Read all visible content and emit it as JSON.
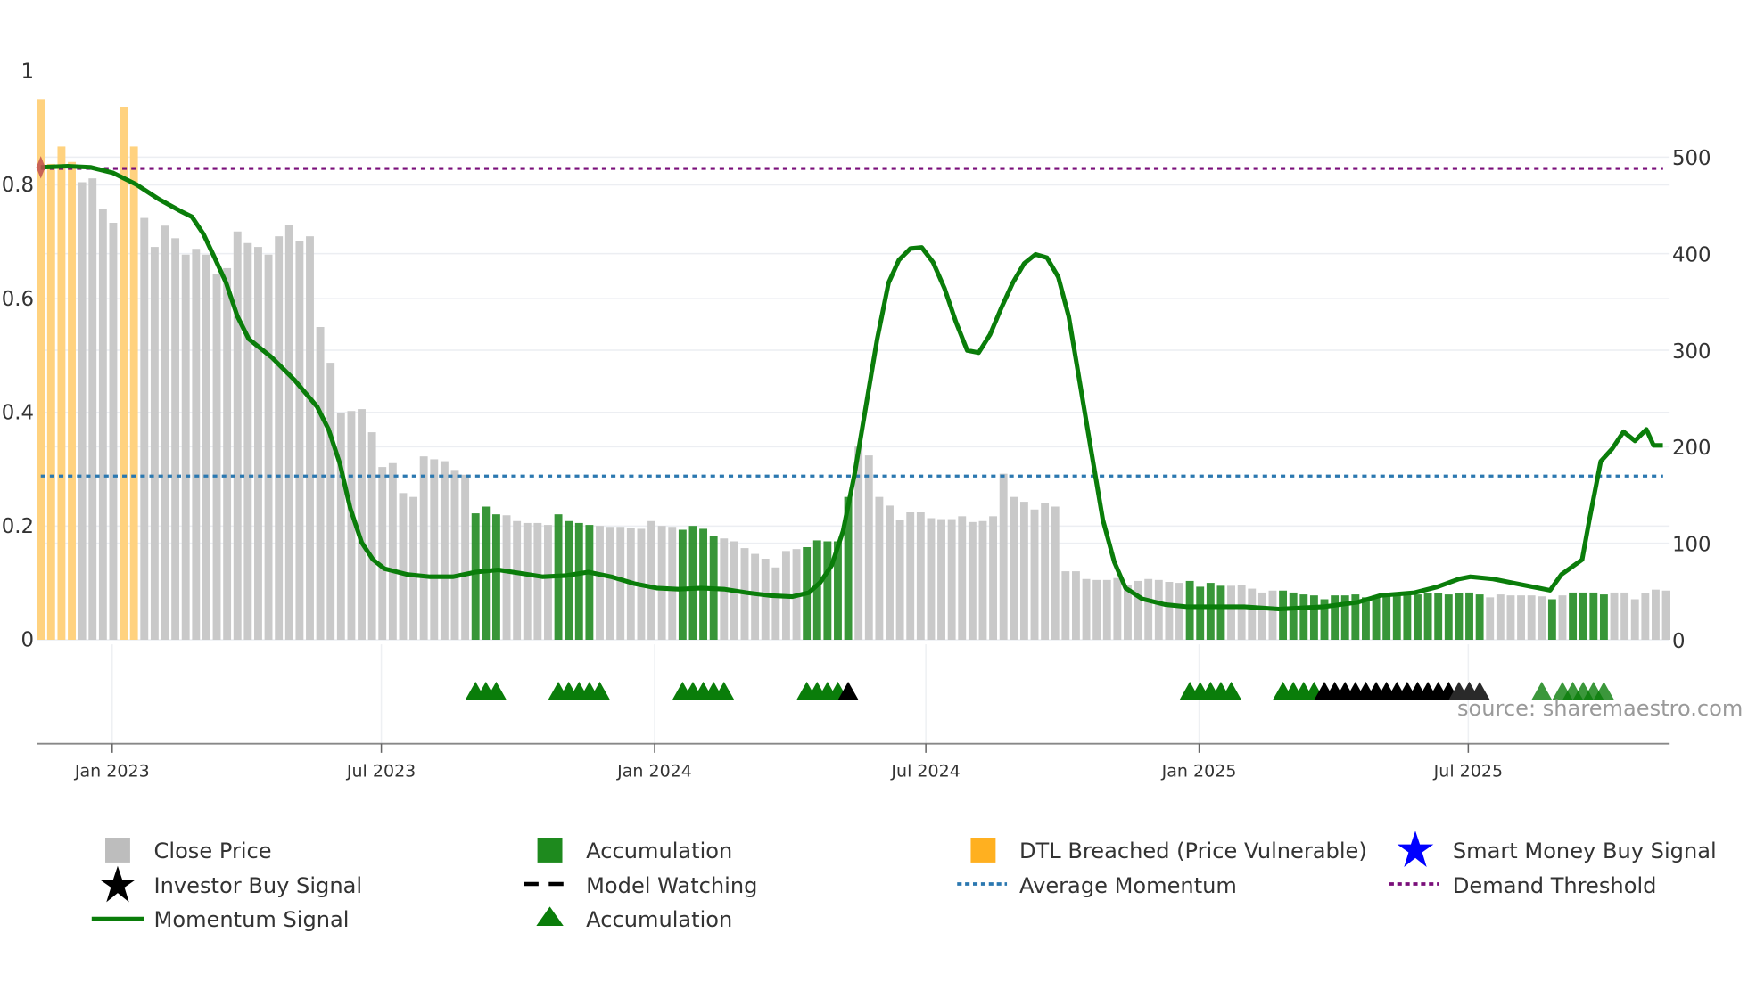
{
  "chart_data": {
    "type": "bar+line",
    "x_unit": "weeks since start",
    "x_ticks": [
      {
        "label": "Jan 2023",
        "week": 6.9
      },
      {
        "label": "Jul 2023",
        "week": 32.9
      },
      {
        "label": "Jan 2024",
        "week": 59.3
      },
      {
        "label": "Jul 2024",
        "week": 85.5
      },
      {
        "label": "Jan 2025",
        "week": 111.9
      },
      {
        "label": "Jul 2025",
        "week": 137.9
      }
    ],
    "left_axis": {
      "ylim": [
        0,
        1
      ],
      "ticks": [
        "0",
        "0.2",
        "0.4",
        "0.6",
        "0.8",
        "1"
      ],
      "tick_values": [
        0,
        0.2,
        0.4,
        0.6,
        0.8,
        1
      ]
    },
    "right_axis": {
      "ylim": [
        0,
        589
      ],
      "ticks": [
        "0",
        "100",
        "200",
        "300",
        "400",
        "500"
      ],
      "tick_values": [
        0,
        100,
        200,
        300,
        400,
        500
      ]
    },
    "close_price": [
      560,
      493,
      511,
      495,
      474,
      478,
      446,
      432,
      552,
      511,
      437,
      407,
      429,
      416,
      399,
      405,
      399,
      379,
      385,
      423,
      411,
      407,
      399,
      418,
      430,
      413,
      418,
      324,
      287,
      235,
      237,
      239,
      215,
      179,
      183,
      152,
      148,
      190,
      187,
      185,
      176,
      171,
      131,
      138,
      130,
      129,
      123,
      121,
      121,
      119,
      130,
      123,
      121,
      119,
      118,
      117,
      117,
      116,
      115,
      123,
      118,
      117,
      114,
      118,
      115,
      108,
      105,
      102,
      95,
      89,
      84,
      75,
      92,
      94,
      96,
      103,
      102,
      102,
      148,
      201,
      191,
      148,
      139,
      124,
      132,
      132,
      126,
      125,
      125,
      128,
      122,
      123,
      128,
      172,
      148,
      143,
      135,
      142,
      138,
      71,
      71,
      63,
      62,
      62,
      64,
      57,
      61,
      63,
      62,
      60,
      59,
      61,
      55,
      59,
      56,
      56,
      57,
      53,
      49,
      51,
      51,
      49,
      47,
      46,
      42,
      46,
      46,
      47,
      44,
      46,
      47,
      47,
      47,
      47,
      48,
      48,
      47,
      48,
      49,
      47,
      44,
      47,
      46,
      46,
      46,
      45,
      42,
      46,
      49,
      49,
      49,
      47,
      49,
      49,
      42,
      48,
      52,
      51
    ],
    "dtl_breached_weeks": [
      [
        0,
        3
      ],
      [
        8,
        9
      ]
    ],
    "accumulation_weeks": [
      [
        42,
        44
      ],
      [
        50,
        53
      ],
      [
        62,
        65
      ],
      [
        74,
        78
      ],
      [
        111,
        114
      ],
      [
        120,
        139
      ],
      [
        146,
        146
      ],
      [
        148,
        151
      ]
    ],
    "momentum_signal": [
      [
        0,
        0.831
      ],
      [
        2.6,
        0.833
      ],
      [
        4.8,
        0.831
      ],
      [
        7.0,
        0.821
      ],
      [
        9.2,
        0.801
      ],
      [
        11.4,
        0.775
      ],
      [
        13.6,
        0.753
      ],
      [
        14.6,
        0.744
      ],
      [
        15.7,
        0.714
      ],
      [
        16.8,
        0.672
      ],
      [
        17.9,
        0.628
      ],
      [
        19.0,
        0.569
      ],
      [
        20.1,
        0.529
      ],
      [
        22.3,
        0.497
      ],
      [
        24.5,
        0.457
      ],
      [
        26.7,
        0.41
      ],
      [
        27.8,
        0.37
      ],
      [
        28.9,
        0.31
      ],
      [
        29.9,
        0.231
      ],
      [
        31.0,
        0.171
      ],
      [
        32.1,
        0.141
      ],
      [
        33.2,
        0.125
      ],
      [
        35.4,
        0.115
      ],
      [
        37.6,
        0.111
      ],
      [
        39.8,
        0.111
      ],
      [
        42.0,
        0.119
      ],
      [
        44.2,
        0.123
      ],
      [
        46.3,
        0.117
      ],
      [
        48.5,
        0.111
      ],
      [
        50.7,
        0.113
      ],
      [
        52.9,
        0.119
      ],
      [
        55.1,
        0.111
      ],
      [
        57.3,
        0.099
      ],
      [
        59.5,
        0.091
      ],
      [
        61.6,
        0.089
      ],
      [
        63.8,
        0.091
      ],
      [
        66.0,
        0.089
      ],
      [
        68.2,
        0.083
      ],
      [
        70.4,
        0.078
      ],
      [
        72.6,
        0.076
      ],
      [
        74.2,
        0.083
      ],
      [
        75.3,
        0.101
      ],
      [
        76.4,
        0.131
      ],
      [
        77.5,
        0.191
      ],
      [
        78.6,
        0.29
      ],
      [
        79.7,
        0.41
      ],
      [
        80.8,
        0.529
      ],
      [
        81.9,
        0.628
      ],
      [
        82.9,
        0.668
      ],
      [
        84.0,
        0.688
      ],
      [
        85.1,
        0.69
      ],
      [
        86.2,
        0.664
      ],
      [
        87.3,
        0.618
      ],
      [
        88.4,
        0.559
      ],
      [
        89.5,
        0.509
      ],
      [
        90.6,
        0.505
      ],
      [
        91.7,
        0.537
      ],
      [
        92.8,
        0.584
      ],
      [
        93.9,
        0.628
      ],
      [
        95.0,
        0.662
      ],
      [
        96.1,
        0.678
      ],
      [
        97.2,
        0.672
      ],
      [
        98.3,
        0.638
      ],
      [
        99.3,
        0.569
      ],
      [
        100.4,
        0.449
      ],
      [
        101.5,
        0.33
      ],
      [
        102.6,
        0.211
      ],
      [
        103.7,
        0.137
      ],
      [
        104.8,
        0.091
      ],
      [
        106.4,
        0.072
      ],
      [
        108.6,
        0.062
      ],
      [
        110.8,
        0.058
      ],
      [
        116.3,
        0.058
      ],
      [
        119.6,
        0.054
      ],
      [
        123.9,
        0.058
      ],
      [
        127.2,
        0.066
      ],
      [
        129.4,
        0.078
      ],
      [
        132.7,
        0.083
      ],
      [
        134.9,
        0.093
      ],
      [
        137.0,
        0.107
      ],
      [
        138.1,
        0.111
      ],
      [
        140.3,
        0.107
      ],
      [
        142.5,
        0.099
      ],
      [
        144.7,
        0.091
      ],
      [
        145.8,
        0.087
      ],
      [
        146.9,
        0.115
      ],
      [
        148.9,
        0.141
      ],
      [
        149.6,
        0.211
      ],
      [
        150.7,
        0.314
      ],
      [
        151.8,
        0.336
      ],
      [
        152.9,
        0.366
      ],
      [
        154.0,
        0.35
      ],
      [
        155.1,
        0.37
      ],
      [
        155.8,
        0.342
      ],
      [
        156.7,
        0.342
      ]
    ],
    "average_momentum": 0.288,
    "demand_threshold": 0.829,
    "accumulation_signal_weeks": [
      42,
      43,
      44,
      50,
      51,
      52,
      53,
      54,
      62,
      63,
      64,
      65,
      66,
      74,
      75,
      76,
      77,
      111,
      112,
      113,
      114,
      115,
      120,
      121,
      122,
      123,
      145,
      147,
      148,
      149,
      150,
      151
    ],
    "model_watching_signal_weeks": [
      78,
      124,
      125,
      126,
      127,
      128,
      129,
      130,
      131,
      132,
      133,
      134,
      135,
      136,
      137,
      138,
      139
    ],
    "legend": {
      "close_price": "Close Price",
      "accumulation_bar": "Accumulation",
      "dtl_breached": "DTL Breached (Price Vulnerable)",
      "smart_money": "Smart Money Buy Signal",
      "investor_buy": "Investor Buy Signal",
      "model_watching": "Model Watching",
      "average_momentum": "Average Momentum",
      "demand_threshold": "Demand Threshold",
      "momentum_signal": "Momentum Signal",
      "accumulation_triangle": "Accumulation"
    },
    "source": "source: sharemaestro.com",
    "colors": {
      "gray": "#c9c9c9",
      "green": "#228b22",
      "yellow": "#ffd27f",
      "line": "#0a7d0a",
      "avg": "#2b78b0",
      "demand": "#7a0f7a"
    }
  }
}
